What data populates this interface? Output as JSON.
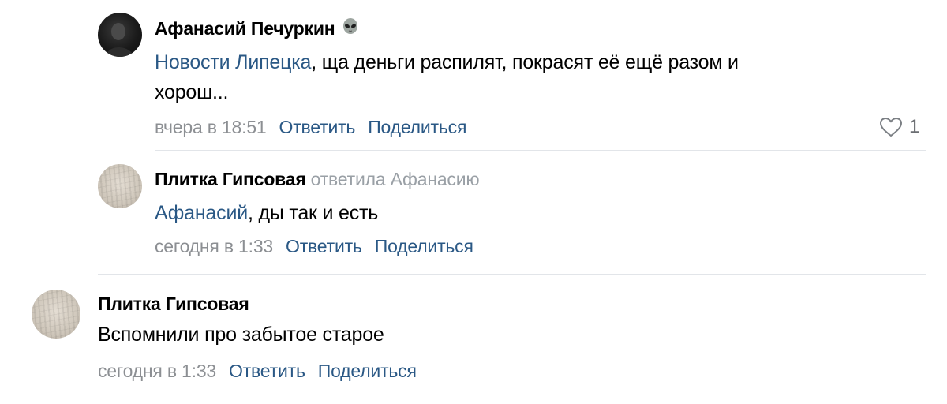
{
  "comments": [
    {
      "author": "Афанасий Печуркин",
      "author_emoji": "alien-emoji",
      "mention": "Новости Липецка",
      "text_line1": ", ща деньги распилят, покрасят её ещё разом и",
      "text_line2": "хорош...",
      "time": "вчера в 18:51",
      "reply_label": "Ответить",
      "share_label": "Поделиться",
      "likes": "1",
      "like_icon": "heart-icon"
    },
    {
      "author": "Плитка Гипсовая",
      "reply_to": "ответила Афанасию",
      "mention": "Афанасий",
      "text": ", ды так и есть",
      "time": "сегодня в 1:33",
      "reply_label": "Ответить",
      "share_label": "Поделиться"
    },
    {
      "author": "Плитка Гипсовая",
      "text": "Вспомнили про забытое старое",
      "time": "сегодня в 1:33",
      "reply_label": "Ответить",
      "share_label": "Поделиться"
    }
  ],
  "colors": {
    "link": "#2a5885",
    "meta": "#8c8f93",
    "divider": "#e2e5e9"
  }
}
